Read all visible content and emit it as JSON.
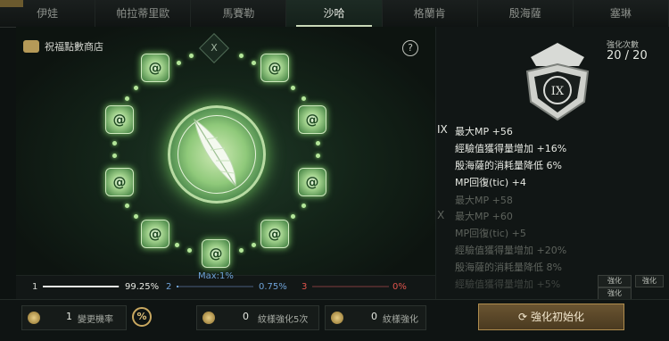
{
  "tabs": [
    "伊娃",
    "帕拉蒂里歐",
    "馬賽勒",
    "沙哈",
    "格蘭肯",
    "殷海薩",
    "塞琳"
  ],
  "active_tab": "沙哈",
  "shop_label": "祝福點數商店",
  "center_badge": "X",
  "help_label": "?",
  "enhance": {
    "label": "強化次數",
    "value": "20 / 20"
  },
  "crest_tier": "IX",
  "stats": {
    "tier9": {
      "roman": "IX",
      "lines": [
        "最大MP +56",
        "經驗值獲得量增加 +16%",
        "殷海薩的消耗量降低 6%",
        "MP回復(tic) +4"
      ]
    },
    "prev": {
      "lines": [
        "最大MP +58"
      ]
    },
    "tier10": {
      "roman": "X",
      "lines": [
        "最大MP +60",
        "MP回復(tic) +5",
        "經驗值獲得量增加 +20%",
        "殷海薩的消耗量降低 8%",
        "經驗值獲得量增加 +5%"
      ]
    },
    "trail": "經驗值獲得量增加 +20%",
    "mini_btn": "強化"
  },
  "probabilities": {
    "max_label": "Max:1%",
    "items": [
      {
        "index": "1",
        "value": "99.25%",
        "fill": 0.99
      },
      {
        "index": "2",
        "value": "0.75%",
        "fill": 0.0075
      },
      {
        "index": "3",
        "value": "0%",
        "fill": 0
      }
    ]
  },
  "bottom": {
    "slot1": {
      "count": "1",
      "label": "變更機率"
    },
    "pct_button": "%",
    "slot2": {
      "count": "0",
      "label": "紋樣強化5次"
    },
    "slot3": {
      "count": "0",
      "label": "紋樣強化"
    },
    "reset_label": "強化初始化"
  },
  "colors": {
    "accent": "#c9a860",
    "glow": "#7fd06a",
    "prob2": "#6fa2d8",
    "prob3": "#e0544c"
  }
}
